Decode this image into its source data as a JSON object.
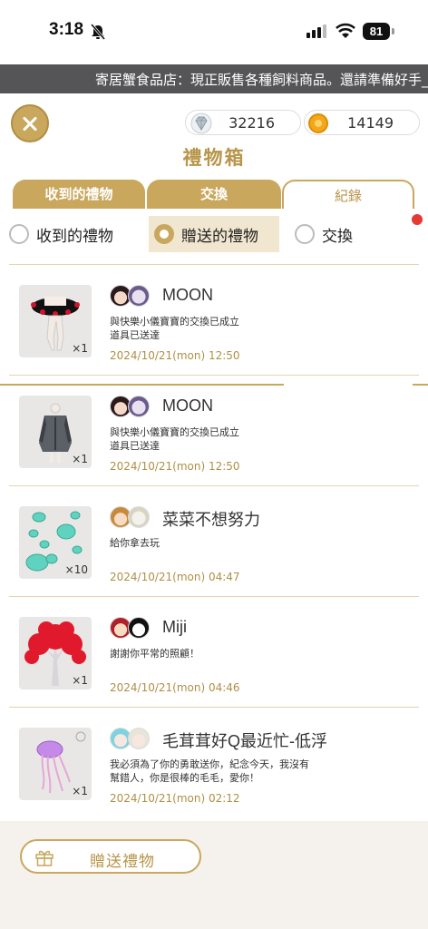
{
  "status_bar": {
    "time": "3:18",
    "battery": "81"
  },
  "marquee": {
    "text": "寄居蟹食品店：現正販售各種飼料商品。還請準備好手_"
  },
  "currency": {
    "diamonds": "32216",
    "coins": "14149"
  },
  "title": "禮物箱",
  "tabs": [
    {
      "label": "收到的禮物"
    },
    {
      "label": "交換"
    },
    {
      "label": "紀錄"
    }
  ],
  "filters": [
    {
      "label": "收到的禮物"
    },
    {
      "label": "贈送的禮物"
    },
    {
      "label": "交換"
    }
  ],
  "gifts": [
    {
      "qty": "×1",
      "sender": "MOON",
      "message": "與快樂小儀寶寶的交換已成立\n道具已送達",
      "date": "2024/10/21(mon) 12:50"
    },
    {
      "qty": "×1",
      "sender": "MOON",
      "message": "與快樂小儀寶寶的交換已成立\n道具已送達",
      "date": "2024/10/21(mon) 12:50"
    },
    {
      "qty": "×10",
      "sender": "菜菜不想努力",
      "message": "給你拿去玩",
      "date": "2024/10/21(mon) 04:47"
    },
    {
      "qty": "×1",
      "sender": "Miji",
      "message": "謝謝你平常的照顧！",
      "date": "2024/10/21(mon) 04:46"
    },
    {
      "qty": "×1",
      "sender": "毛茸茸好Q最近忙-低浮",
      "message": "我必須為了你的勇敢送你，紀念今天，我沒有幫錯人，你是很棒的毛毛，愛你！",
      "date": "2024/10/21(mon) 02:12"
    }
  ],
  "footer": {
    "send_label": "贈送禮物"
  },
  "colors": {
    "accent": "#c9a75d",
    "title": "#b8954a",
    "notification": "#e53935"
  }
}
